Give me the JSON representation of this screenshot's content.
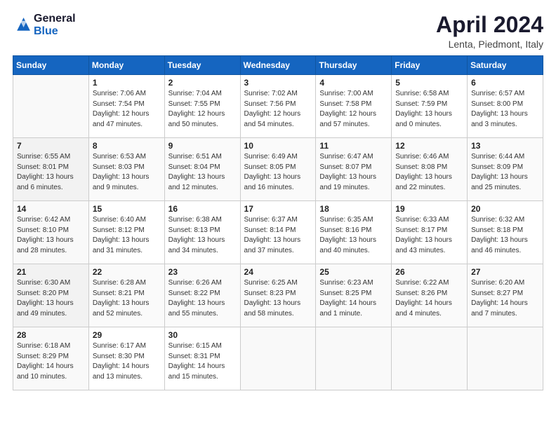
{
  "header": {
    "logo_line1": "General",
    "logo_line2": "Blue",
    "month": "April 2024",
    "location": "Lenta, Piedmont, Italy"
  },
  "weekdays": [
    "Sunday",
    "Monday",
    "Tuesday",
    "Wednesday",
    "Thursday",
    "Friday",
    "Saturday"
  ],
  "weeks": [
    [
      {
        "day": "",
        "sunrise": "",
        "sunset": "",
        "daylight": ""
      },
      {
        "day": "1",
        "sunrise": "Sunrise: 7:06 AM",
        "sunset": "Sunset: 7:54 PM",
        "daylight": "Daylight: 12 hours and 47 minutes."
      },
      {
        "day": "2",
        "sunrise": "Sunrise: 7:04 AM",
        "sunset": "Sunset: 7:55 PM",
        "daylight": "Daylight: 12 hours and 50 minutes."
      },
      {
        "day": "3",
        "sunrise": "Sunrise: 7:02 AM",
        "sunset": "Sunset: 7:56 PM",
        "daylight": "Daylight: 12 hours and 54 minutes."
      },
      {
        "day": "4",
        "sunrise": "Sunrise: 7:00 AM",
        "sunset": "Sunset: 7:58 PM",
        "daylight": "Daylight: 12 hours and 57 minutes."
      },
      {
        "day": "5",
        "sunrise": "Sunrise: 6:58 AM",
        "sunset": "Sunset: 7:59 PM",
        "daylight": "Daylight: 13 hours and 0 minutes."
      },
      {
        "day": "6",
        "sunrise": "Sunrise: 6:57 AM",
        "sunset": "Sunset: 8:00 PM",
        "daylight": "Daylight: 13 hours and 3 minutes."
      }
    ],
    [
      {
        "day": "7",
        "sunrise": "Sunrise: 6:55 AM",
        "sunset": "Sunset: 8:01 PM",
        "daylight": "Daylight: 13 hours and 6 minutes."
      },
      {
        "day": "8",
        "sunrise": "Sunrise: 6:53 AM",
        "sunset": "Sunset: 8:03 PM",
        "daylight": "Daylight: 13 hours and 9 minutes."
      },
      {
        "day": "9",
        "sunrise": "Sunrise: 6:51 AM",
        "sunset": "Sunset: 8:04 PM",
        "daylight": "Daylight: 13 hours and 12 minutes."
      },
      {
        "day": "10",
        "sunrise": "Sunrise: 6:49 AM",
        "sunset": "Sunset: 8:05 PM",
        "daylight": "Daylight: 13 hours and 16 minutes."
      },
      {
        "day": "11",
        "sunrise": "Sunrise: 6:47 AM",
        "sunset": "Sunset: 8:07 PM",
        "daylight": "Daylight: 13 hours and 19 minutes."
      },
      {
        "day": "12",
        "sunrise": "Sunrise: 6:46 AM",
        "sunset": "Sunset: 8:08 PM",
        "daylight": "Daylight: 13 hours and 22 minutes."
      },
      {
        "day": "13",
        "sunrise": "Sunrise: 6:44 AM",
        "sunset": "Sunset: 8:09 PM",
        "daylight": "Daylight: 13 hours and 25 minutes."
      }
    ],
    [
      {
        "day": "14",
        "sunrise": "Sunrise: 6:42 AM",
        "sunset": "Sunset: 8:10 PM",
        "daylight": "Daylight: 13 hours and 28 minutes."
      },
      {
        "day": "15",
        "sunrise": "Sunrise: 6:40 AM",
        "sunset": "Sunset: 8:12 PM",
        "daylight": "Daylight: 13 hours and 31 minutes."
      },
      {
        "day": "16",
        "sunrise": "Sunrise: 6:38 AM",
        "sunset": "Sunset: 8:13 PM",
        "daylight": "Daylight: 13 hours and 34 minutes."
      },
      {
        "day": "17",
        "sunrise": "Sunrise: 6:37 AM",
        "sunset": "Sunset: 8:14 PM",
        "daylight": "Daylight: 13 hours and 37 minutes."
      },
      {
        "day": "18",
        "sunrise": "Sunrise: 6:35 AM",
        "sunset": "Sunset: 8:16 PM",
        "daylight": "Daylight: 13 hours and 40 minutes."
      },
      {
        "day": "19",
        "sunrise": "Sunrise: 6:33 AM",
        "sunset": "Sunset: 8:17 PM",
        "daylight": "Daylight: 13 hours and 43 minutes."
      },
      {
        "day": "20",
        "sunrise": "Sunrise: 6:32 AM",
        "sunset": "Sunset: 8:18 PM",
        "daylight": "Daylight: 13 hours and 46 minutes."
      }
    ],
    [
      {
        "day": "21",
        "sunrise": "Sunrise: 6:30 AM",
        "sunset": "Sunset: 8:20 PM",
        "daylight": "Daylight: 13 hours and 49 minutes."
      },
      {
        "day": "22",
        "sunrise": "Sunrise: 6:28 AM",
        "sunset": "Sunset: 8:21 PM",
        "daylight": "Daylight: 13 hours and 52 minutes."
      },
      {
        "day": "23",
        "sunrise": "Sunrise: 6:26 AM",
        "sunset": "Sunset: 8:22 PM",
        "daylight": "Daylight: 13 hours and 55 minutes."
      },
      {
        "day": "24",
        "sunrise": "Sunrise: 6:25 AM",
        "sunset": "Sunset: 8:23 PM",
        "daylight": "Daylight: 13 hours and 58 minutes."
      },
      {
        "day": "25",
        "sunrise": "Sunrise: 6:23 AM",
        "sunset": "Sunset: 8:25 PM",
        "daylight": "Daylight: 14 hours and 1 minute."
      },
      {
        "day": "26",
        "sunrise": "Sunrise: 6:22 AM",
        "sunset": "Sunset: 8:26 PM",
        "daylight": "Daylight: 14 hours and 4 minutes."
      },
      {
        "day": "27",
        "sunrise": "Sunrise: 6:20 AM",
        "sunset": "Sunset: 8:27 PM",
        "daylight": "Daylight: 14 hours and 7 minutes."
      }
    ],
    [
      {
        "day": "28",
        "sunrise": "Sunrise: 6:18 AM",
        "sunset": "Sunset: 8:29 PM",
        "daylight": "Daylight: 14 hours and 10 minutes."
      },
      {
        "day": "29",
        "sunrise": "Sunrise: 6:17 AM",
        "sunset": "Sunset: 8:30 PM",
        "daylight": "Daylight: 14 hours and 13 minutes."
      },
      {
        "day": "30",
        "sunrise": "Sunrise: 6:15 AM",
        "sunset": "Sunset: 8:31 PM",
        "daylight": "Daylight: 14 hours and 15 minutes."
      },
      {
        "day": "",
        "sunrise": "",
        "sunset": "",
        "daylight": ""
      },
      {
        "day": "",
        "sunrise": "",
        "sunset": "",
        "daylight": ""
      },
      {
        "day": "",
        "sunrise": "",
        "sunset": "",
        "daylight": ""
      },
      {
        "day": "",
        "sunrise": "",
        "sunset": "",
        "daylight": ""
      }
    ]
  ]
}
